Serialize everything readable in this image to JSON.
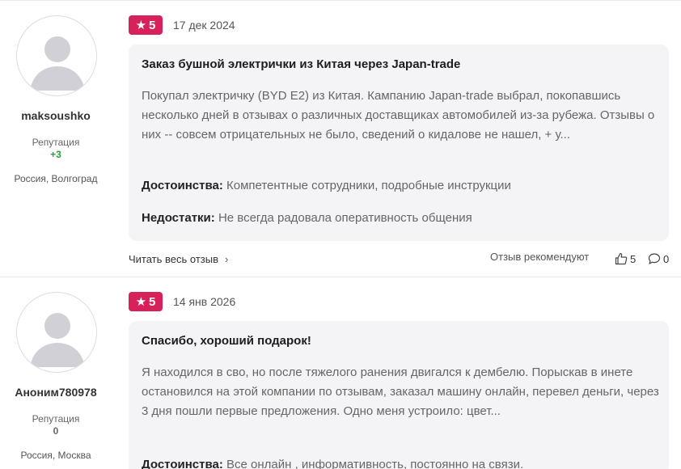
{
  "reviews": [
    {
      "username": "maksoushko",
      "reputation_label": "Репутация",
      "reputation_value": "+3",
      "location": "Россия, Волгоград",
      "rating": "5",
      "date": "17 дек 2024",
      "title": "Заказ бушной электрички из Китая через Japan-trade",
      "text": "Покупал электричку (BYD E2) из Китая. Кампанию Japan-trade выбрал, покопавшись несколько дней в отзывах о различных доставщиках автомобилей из-за рубежа. Отзывы о них -- совсем отрицательных не было, сведений о кидалове не нашел, + у...",
      "pros_label": "Достоинства:",
      "pros_text": "Компетентные сотрудники, подробные инструкции",
      "cons_label": "Недостатки:",
      "cons_text": "Не всегда радовала оперативность общения",
      "read_more": "Читать весь отзыв",
      "recommend": "Отзыв рекомендуют",
      "likes": "5",
      "comments": "0"
    },
    {
      "username": "Аноним780978",
      "reputation_label": "Репутация",
      "reputation_value": "0",
      "location": "Россия, Москва",
      "rating": "5",
      "date": "14 янв 2026",
      "title": "Спасибо, хороший подарок!",
      "text": "Я находился в сво, но после тяжелого ранения двигался к дембелю. Порыскав в инете остановился на этой компании по отзывам, заказал машину онлайн, перевел деньги, через 3 дня пошли первые предложения. Одно меня устроило: цвет...",
      "pros_label": "Достоинства:",
      "pros_text": "Все онлайн , информативность, постоянно на связи."
    }
  ],
  "colors": {
    "rating_badge": "#d6215a",
    "reputation_positive": "#2e9e3e",
    "card_background": "#f4f4f7"
  },
  "icons": [
    "star-icon",
    "avatar-placeholder-icon",
    "chevron-right-icon",
    "thumbs-up-icon",
    "comment-icon"
  ]
}
